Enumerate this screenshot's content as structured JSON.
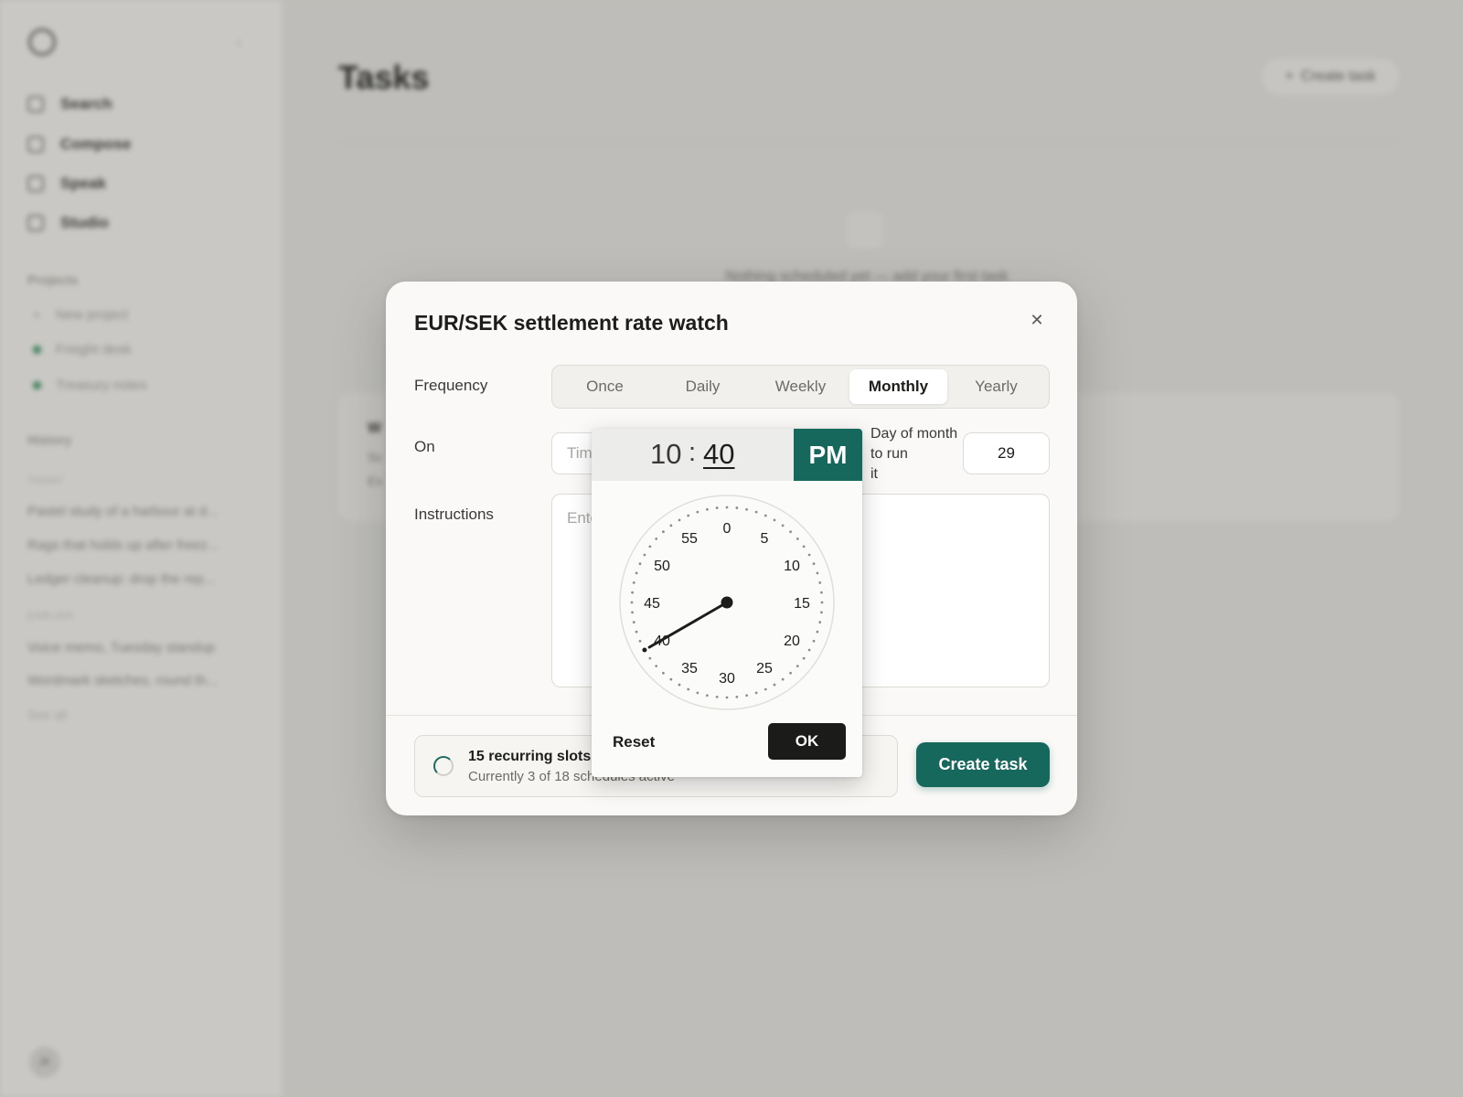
{
  "sidebar": {
    "nav": [
      {
        "label": "Search",
        "icon": "search-icon"
      },
      {
        "label": "Compose",
        "icon": "pencil-icon"
      },
      {
        "label": "Speak",
        "icon": "microphone-icon"
      },
      {
        "label": "Studio",
        "icon": "grid-icon"
      }
    ],
    "projects_heading": "Projects",
    "projects": [
      {
        "label": "New project",
        "icon": "plus-icon"
      },
      {
        "label": "Freight desk",
        "icon": "dot-icon"
      },
      {
        "label": "Treasury notes",
        "icon": "dot-icon"
      }
    ],
    "history_heading": "History",
    "today_caption": "TODAY",
    "today_items": [
      "Pastel study of a harbour at d...",
      "Rags that holds up after freez...",
      "Ledger cleanup: drop the rep..."
    ],
    "earlier_caption": "EARLIER",
    "earlier_items": [
      "Voice memo, Tuesday standup",
      "Wordmark sketches, round th..."
    ],
    "see_all": "See all",
    "user_initials": "JK"
  },
  "main": {
    "title": "Tasks",
    "create_button": "Create task",
    "empty_text": "Nothing scheduled yet — add your first task",
    "card": {
      "title": "W",
      "line1": "Sc",
      "line2": "Ev"
    }
  },
  "modal": {
    "title": "EUR/SEK settlement rate watch",
    "frequency_label": "Frequency",
    "frequency_options": [
      "Once",
      "Daily",
      "Weekly",
      "Monthly",
      "Yearly"
    ],
    "frequency_selected": "Monthly",
    "on_label": "On",
    "time_placeholder": "Time",
    "day_label_line1": "Day of month to run",
    "day_label_line2": "it",
    "day_value": "29",
    "instructions_label": "Instructions",
    "instructions_placeholder": "Enter instructions",
    "status_title": "15 recurring slots",
    "status_sub": "Currently 3 of 18 schedules active",
    "create_button": "Create task"
  },
  "time_picker": {
    "hour": "10",
    "separator": ":",
    "minute": "40",
    "period": "PM",
    "dial_labels": [
      "0",
      "5",
      "10",
      "15",
      "20",
      "25",
      "30",
      "35",
      "40",
      "45",
      "50",
      "55"
    ],
    "selected_minute": 40,
    "reset_label": "Reset",
    "ok_label": "OK",
    "accent_color": "#16675c"
  }
}
